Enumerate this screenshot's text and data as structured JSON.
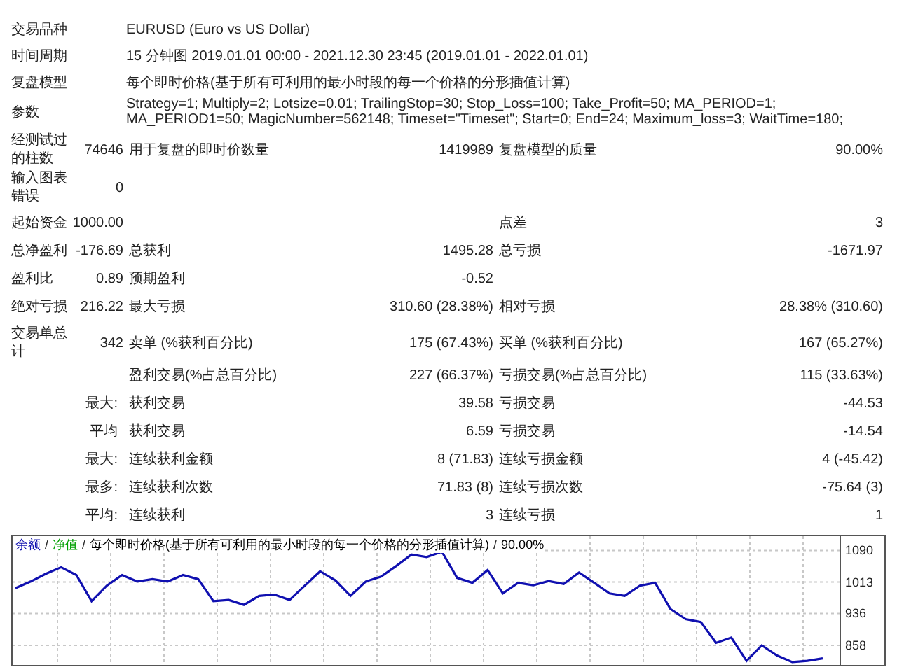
{
  "header": [
    {
      "label": "交易品种",
      "value": "EURUSD (Euro vs US Dollar)"
    },
    {
      "label": "时间周期",
      "value": "15 分钟图 2019.01.01 00:00 - 2021.12.30 23:45 (2019.01.01 - 2022.01.01)"
    },
    {
      "label": "复盘模型",
      "value": "每个即时价格(基于所有可利用的最小时段的每一个价格的分形插值计算)"
    },
    {
      "label": "参数",
      "value": "Strategy=1; Multiply=2; Lotsize=0.01; TrailingStop=30; Stop_Loss=100; Take_Profit=50; MA_PERIOD=1; MA_PERIOD1=50; MagicNumber=562148; Timeset=\"Timeset\"; Start=0; End=24; Maximum_loss=3; WaitTime=180;"
    }
  ],
  "sections": [
    [
      {
        "label": "经测试过的柱数",
        "value": "74646",
        "label_2": "用于复盘的即时价数量",
        "value_2": "1419989",
        "label_3": "复盘模型的质量",
        "value_3": "90.00%"
      },
      {
        "label": "输入图表错误",
        "value": "0"
      }
    ],
    [
      {
        "label": "起始资金",
        "value": "1000.00",
        "label_3": "点差",
        "value_3": "3"
      },
      {
        "label": "总净盈利",
        "value": "-176.69",
        "label_2": "总获利",
        "value_2": "1495.28",
        "label_3": "总亏损",
        "value_3": "-1671.97"
      },
      {
        "label": "盈利比",
        "value": "0.89",
        "label_2": "预期盈利",
        "value_2": "-0.52"
      },
      {
        "label": "绝对亏损",
        "value": "216.22",
        "label_2": "最大亏损",
        "value_2": "310.60 (28.38%)",
        "label_3": "相对亏损",
        "value_3": "28.38% (310.60)"
      }
    ],
    [
      {
        "label": "交易单总计",
        "value": "342",
        "label_2": "卖单 (%获利百分比)",
        "value_2": "175 (67.43%)",
        "label_3": "买单 (%获利百分比)",
        "value_3": "167 (65.27%)"
      },
      {
        "label_2": "盈利交易(%占总百分比)",
        "value_2": "227 (66.37%)",
        "label_3": "亏损交易(%占总百分比)",
        "value_3": "115 (33.63%)"
      },
      {
        "caption": "最大:",
        "label_2": "获利交易",
        "value_2": "39.58",
        "label_3": "亏损交易",
        "value_3": "-44.53"
      },
      {
        "caption": "平均",
        "label_2": "获利交易",
        "value_2": "6.59",
        "label_3": "亏损交易",
        "value_3": "-14.54"
      },
      {
        "caption": "最大:",
        "label_2": "连续获利金额",
        "value_2": "8 (71.83)",
        "label_3": "连续亏损金额",
        "value_3": "4 (-45.42)"
      },
      {
        "caption": "最多:",
        "label_2": "连续获利次数",
        "value_2": "71.83 (8)",
        "label_3": "连续亏损次数",
        "value_3": "-75.64 (3)"
      },
      {
        "caption": "平均:",
        "label_2": "连续获利",
        "value_2": "3",
        "label_3": "连续亏损",
        "value_3": "1"
      }
    ]
  ],
  "chart": {
    "legend": [
      {
        "separator": "/"
      },
      {
        "text": "净值",
        "color": "#00a000"
      },
      {
        "separator": "/"
      },
      {
        "text": "每个即时价格(基于所有可利用的最小时段的每一个价格的分形插值计算)",
        "color": "#000000"
      },
      {
        "separator": "/"
      },
      {
        "text": "90.00%",
        "color": "#000000"
      }
    ],
    "chart_data": {
      "type": "line",
      "grid": true,
      "ylim": [
        810,
        1125
      ],
      "yticks": [
        1090,
        1013,
        936,
        858
      ],
      "series": [
        {
          "name": "余额",
          "color": "#1010b0",
          "values": [
            998,
            1014,
            1033,
            1049,
            1030,
            966,
            1004,
            1030,
            1014,
            1020,
            1014,
            1030,
            1020,
            966,
            969,
            957,
            979,
            982,
            969,
            1004,
            1039,
            1017,
            979,
            1014,
            1026,
            1052,
            1080,
            1074,
            1087,
            1023,
            1011,
            1042,
            985,
            1011,
            1005,
            1015,
            1008,
            1036,
            1011,
            985,
            979,
            1004,
            1011,
            947,
            922,
            915,
            864,
            877,
            820,
            858,
            833,
            817,
            820,
            826
          ]
        }
      ]
    }
  }
}
